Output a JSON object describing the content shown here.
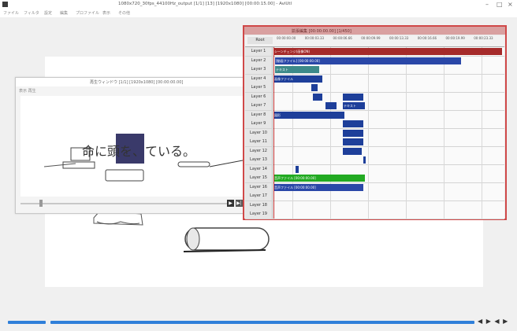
{
  "main_window": {
    "title": "1080x720_30fps_44100Hz_output [1/1] [13] [1920x1080] [00:00:15.00] - AviUtl",
    "menu": [
      "ファイル",
      "フィルタ",
      "設定",
      "編集",
      "プロファイル",
      "表示",
      "その他"
    ],
    "minimize_icon": "minimize-icon",
    "maximize_icon": "maximize-icon",
    "close_icon": "close-icon"
  },
  "preview": {
    "subtitle_text": "命に頭を、ている。"
  },
  "subwindow": {
    "title": "再生ウィンドウ [1/1] [1920x1080] [00:00:00.00]",
    "menu": "表示 再生",
    "play_label": "▶",
    "next_label": "▶|"
  },
  "timeline": {
    "title": "拡張編集 [00:00:00.00] [1/450]",
    "ruler_label": "Root",
    "ticks": [
      "00:00:00.00",
      "00:00:03.33",
      "00:00:06.66",
      "00:00:09.99",
      "00:00:13.33",
      "00:00:16.66",
      "00:00:19.99",
      "00:00:23.33"
    ],
    "layers": [
      "Layer 1",
      "Layer 2",
      "Layer 3",
      "Layer 4",
      "Layer 5",
      "Layer 6",
      "Layer 7",
      "Layer 8",
      "Layer 9",
      "Layer 10",
      "Layer 11",
      "Layer 12",
      "Layer 13",
      "Layer 14",
      "Layer 15",
      "Layer 16",
      "Layer 17",
      "Layer 18",
      "Layer 19"
    ],
    "clips": [
      {
        "layer": 0,
        "label": "シーンチェンジ(画像ON)",
        "color": "#a52a2a"
      },
      {
        "layer": 1,
        "label": "[動画ファイル] [00:00:00.00]",
        "color": "#2a47a8"
      },
      {
        "layer": 2,
        "label": "テキスト",
        "color": "#3d8a8a"
      },
      {
        "layer": 3,
        "label": "画像ファイル",
        "color": "#1e3f9a"
      },
      {
        "layer": 5,
        "label": "",
        "color": "#1e3f9a"
      },
      {
        "layer": 6,
        "label": "テキスト",
        "color": "#1e3f9a"
      },
      {
        "layer": 7,
        "label": "図形",
        "color": "#1e3f9a"
      },
      {
        "layer": 14,
        "label": "音声ファイル [00:00:00.00]",
        "color": "#22aa22"
      },
      {
        "layer": 15,
        "label": "音声ファイル [00:00:00.00]",
        "color": "#2a47a8"
      }
    ]
  },
  "footer": {
    "nav_icons": "◀ ▶ ◀ ▶"
  }
}
